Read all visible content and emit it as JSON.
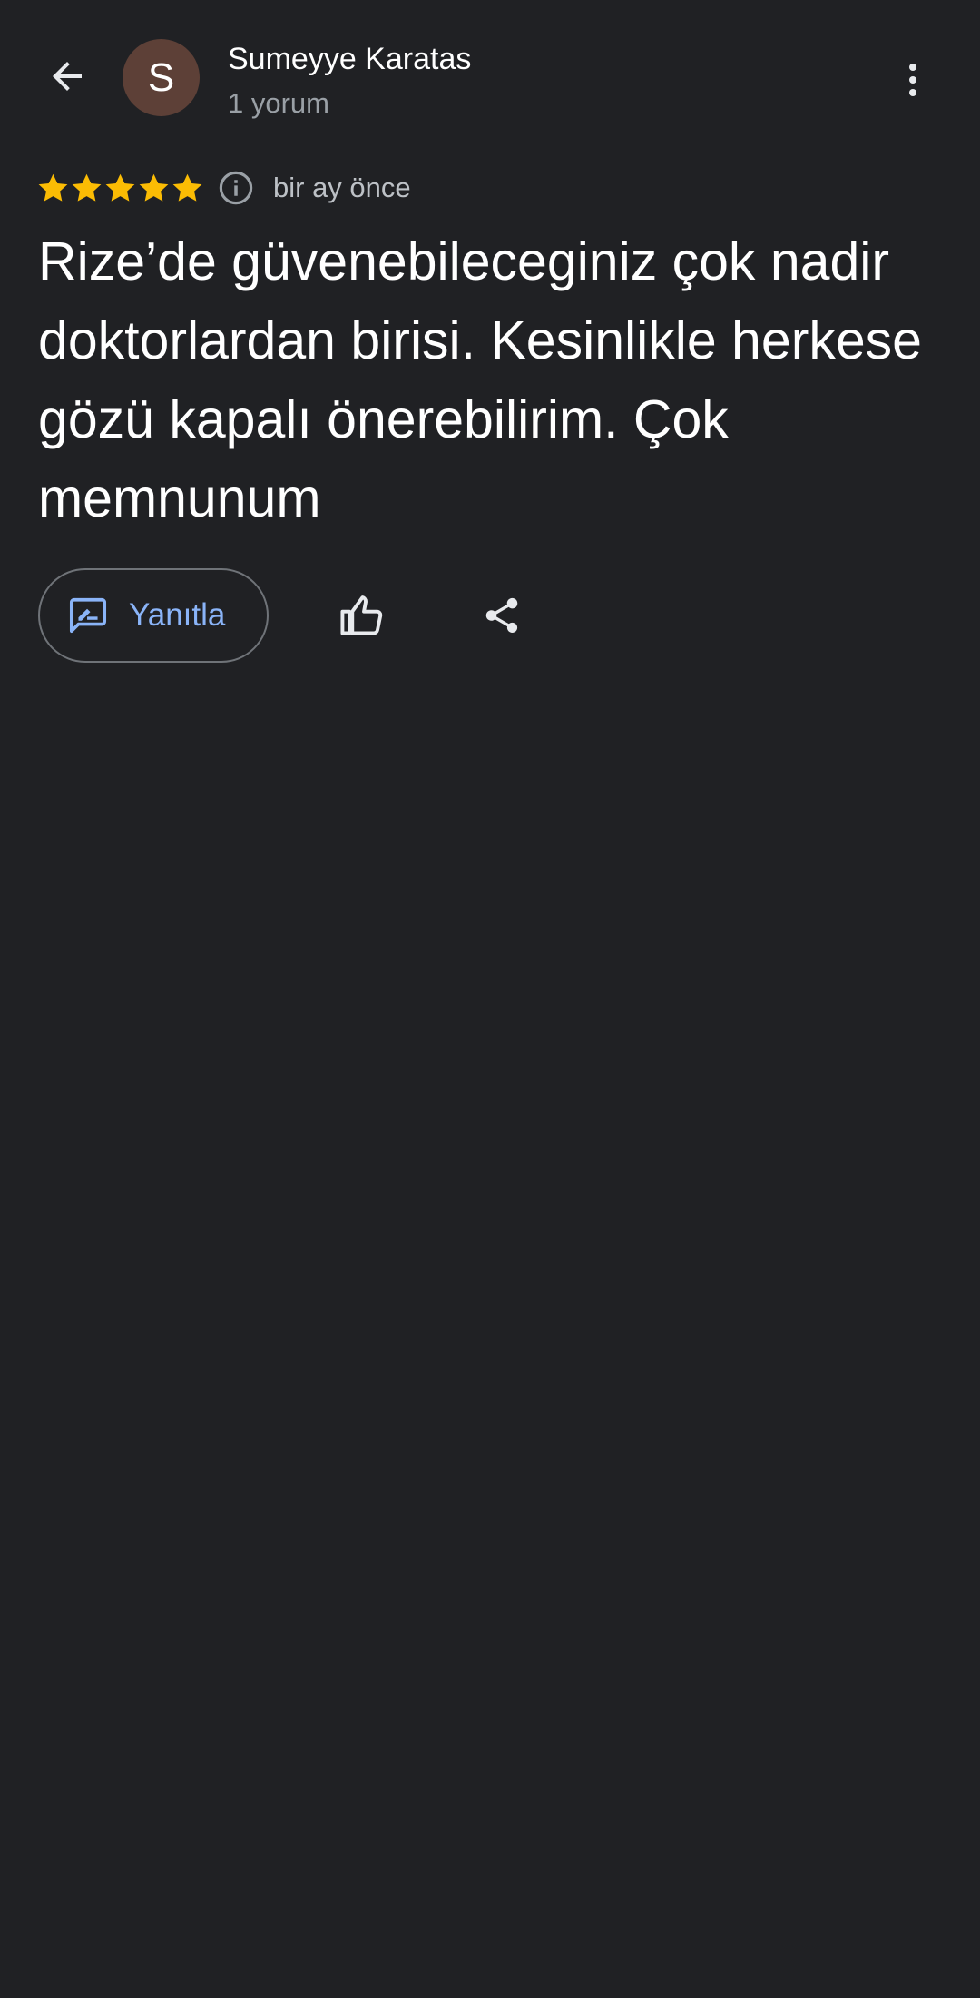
{
  "header": {
    "back_icon": "arrow-back-icon",
    "avatar_letter": "S",
    "avatar_color": "#5d4037",
    "user_name": "Sumeyye Karatas",
    "user_reviews": "1 yorum",
    "more_icon": "more-vert-icon"
  },
  "review": {
    "rating": 5,
    "rating_max": 5,
    "star_color": "#fbbc04",
    "info_icon": "info-icon",
    "date": "bir ay önce",
    "text": "Rize’de güvenebileceginiz çok nadir doktorlardan birisi. Kesinlikle herkese gözü kapalı önerebilirim. Çok memnunum"
  },
  "actions": {
    "reply_label": "Yanıtla",
    "reply_icon": "rate-review-icon",
    "like_icon": "thumb-up-icon",
    "share_icon": "share-icon",
    "accent_color": "#8ab4f8"
  }
}
